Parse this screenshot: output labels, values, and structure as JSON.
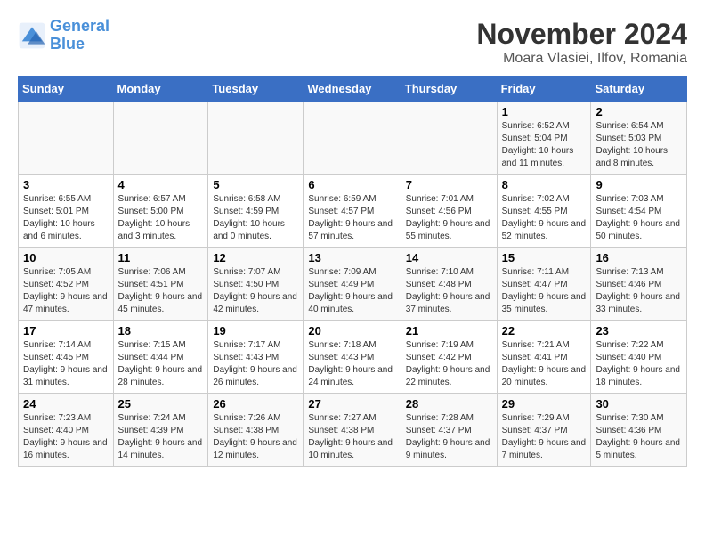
{
  "logo": {
    "line1": "General",
    "line2": "Blue"
  },
  "title": "November 2024",
  "subtitle": "Moara Vlasiei, Ilfov, Romania",
  "weekdays": [
    "Sunday",
    "Monday",
    "Tuesday",
    "Wednesday",
    "Thursday",
    "Friday",
    "Saturday"
  ],
  "weeks": [
    [
      {
        "day": "",
        "info": ""
      },
      {
        "day": "",
        "info": ""
      },
      {
        "day": "",
        "info": ""
      },
      {
        "day": "",
        "info": ""
      },
      {
        "day": "",
        "info": ""
      },
      {
        "day": "1",
        "info": "Sunrise: 6:52 AM\nSunset: 5:04 PM\nDaylight: 10 hours and 11 minutes."
      },
      {
        "day": "2",
        "info": "Sunrise: 6:54 AM\nSunset: 5:03 PM\nDaylight: 10 hours and 8 minutes."
      }
    ],
    [
      {
        "day": "3",
        "info": "Sunrise: 6:55 AM\nSunset: 5:01 PM\nDaylight: 10 hours and 6 minutes."
      },
      {
        "day": "4",
        "info": "Sunrise: 6:57 AM\nSunset: 5:00 PM\nDaylight: 10 hours and 3 minutes."
      },
      {
        "day": "5",
        "info": "Sunrise: 6:58 AM\nSunset: 4:59 PM\nDaylight: 10 hours and 0 minutes."
      },
      {
        "day": "6",
        "info": "Sunrise: 6:59 AM\nSunset: 4:57 PM\nDaylight: 9 hours and 57 minutes."
      },
      {
        "day": "7",
        "info": "Sunrise: 7:01 AM\nSunset: 4:56 PM\nDaylight: 9 hours and 55 minutes."
      },
      {
        "day": "8",
        "info": "Sunrise: 7:02 AM\nSunset: 4:55 PM\nDaylight: 9 hours and 52 minutes."
      },
      {
        "day": "9",
        "info": "Sunrise: 7:03 AM\nSunset: 4:54 PM\nDaylight: 9 hours and 50 minutes."
      }
    ],
    [
      {
        "day": "10",
        "info": "Sunrise: 7:05 AM\nSunset: 4:52 PM\nDaylight: 9 hours and 47 minutes."
      },
      {
        "day": "11",
        "info": "Sunrise: 7:06 AM\nSunset: 4:51 PM\nDaylight: 9 hours and 45 minutes."
      },
      {
        "day": "12",
        "info": "Sunrise: 7:07 AM\nSunset: 4:50 PM\nDaylight: 9 hours and 42 minutes."
      },
      {
        "day": "13",
        "info": "Sunrise: 7:09 AM\nSunset: 4:49 PM\nDaylight: 9 hours and 40 minutes."
      },
      {
        "day": "14",
        "info": "Sunrise: 7:10 AM\nSunset: 4:48 PM\nDaylight: 9 hours and 37 minutes."
      },
      {
        "day": "15",
        "info": "Sunrise: 7:11 AM\nSunset: 4:47 PM\nDaylight: 9 hours and 35 minutes."
      },
      {
        "day": "16",
        "info": "Sunrise: 7:13 AM\nSunset: 4:46 PM\nDaylight: 9 hours and 33 minutes."
      }
    ],
    [
      {
        "day": "17",
        "info": "Sunrise: 7:14 AM\nSunset: 4:45 PM\nDaylight: 9 hours and 31 minutes."
      },
      {
        "day": "18",
        "info": "Sunrise: 7:15 AM\nSunset: 4:44 PM\nDaylight: 9 hours and 28 minutes."
      },
      {
        "day": "19",
        "info": "Sunrise: 7:17 AM\nSunset: 4:43 PM\nDaylight: 9 hours and 26 minutes."
      },
      {
        "day": "20",
        "info": "Sunrise: 7:18 AM\nSunset: 4:43 PM\nDaylight: 9 hours and 24 minutes."
      },
      {
        "day": "21",
        "info": "Sunrise: 7:19 AM\nSunset: 4:42 PM\nDaylight: 9 hours and 22 minutes."
      },
      {
        "day": "22",
        "info": "Sunrise: 7:21 AM\nSunset: 4:41 PM\nDaylight: 9 hours and 20 minutes."
      },
      {
        "day": "23",
        "info": "Sunrise: 7:22 AM\nSunset: 4:40 PM\nDaylight: 9 hours and 18 minutes."
      }
    ],
    [
      {
        "day": "24",
        "info": "Sunrise: 7:23 AM\nSunset: 4:40 PM\nDaylight: 9 hours and 16 minutes."
      },
      {
        "day": "25",
        "info": "Sunrise: 7:24 AM\nSunset: 4:39 PM\nDaylight: 9 hours and 14 minutes."
      },
      {
        "day": "26",
        "info": "Sunrise: 7:26 AM\nSunset: 4:38 PM\nDaylight: 9 hours and 12 minutes."
      },
      {
        "day": "27",
        "info": "Sunrise: 7:27 AM\nSunset: 4:38 PM\nDaylight: 9 hours and 10 minutes."
      },
      {
        "day": "28",
        "info": "Sunrise: 7:28 AM\nSunset: 4:37 PM\nDaylight: 9 hours and 9 minutes."
      },
      {
        "day": "29",
        "info": "Sunrise: 7:29 AM\nSunset: 4:37 PM\nDaylight: 9 hours and 7 minutes."
      },
      {
        "day": "30",
        "info": "Sunrise: 7:30 AM\nSunset: 4:36 PM\nDaylight: 9 hours and 5 minutes."
      }
    ]
  ]
}
